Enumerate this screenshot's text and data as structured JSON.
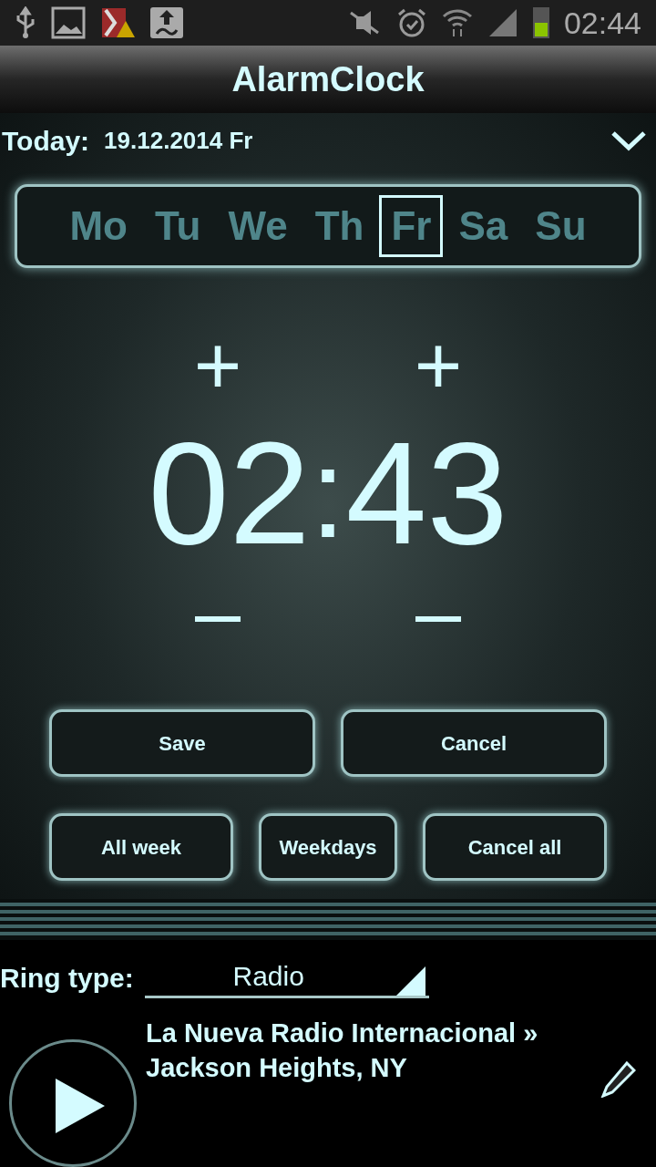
{
  "status_bar": {
    "time": "02:44"
  },
  "title": "AlarmClock",
  "today": {
    "label": "Today:",
    "date": "19.12.2014 Fr"
  },
  "days": [
    {
      "label": "Mo",
      "selected": false
    },
    {
      "label": "Tu",
      "selected": false
    },
    {
      "label": "We",
      "selected": false
    },
    {
      "label": "Th",
      "selected": false
    },
    {
      "label": "Fr",
      "selected": true
    },
    {
      "label": "Sa",
      "selected": false
    },
    {
      "label": "Su",
      "selected": false
    }
  ],
  "time": {
    "hours": "02",
    "separator": ":",
    "minutes": "43",
    "increment": "+",
    "decrement": "–"
  },
  "buttons_row_1": [
    "Save",
    "Cancel"
  ],
  "buttons_row_2": [
    "All week",
    "Weekdays",
    "Cancel all"
  ],
  "ring_type": {
    "label": "Ring type:",
    "value": "Radio"
  },
  "station": {
    "name": "La Nueva Radio Internacional »",
    "location": "Jackson Heights, NY"
  }
}
